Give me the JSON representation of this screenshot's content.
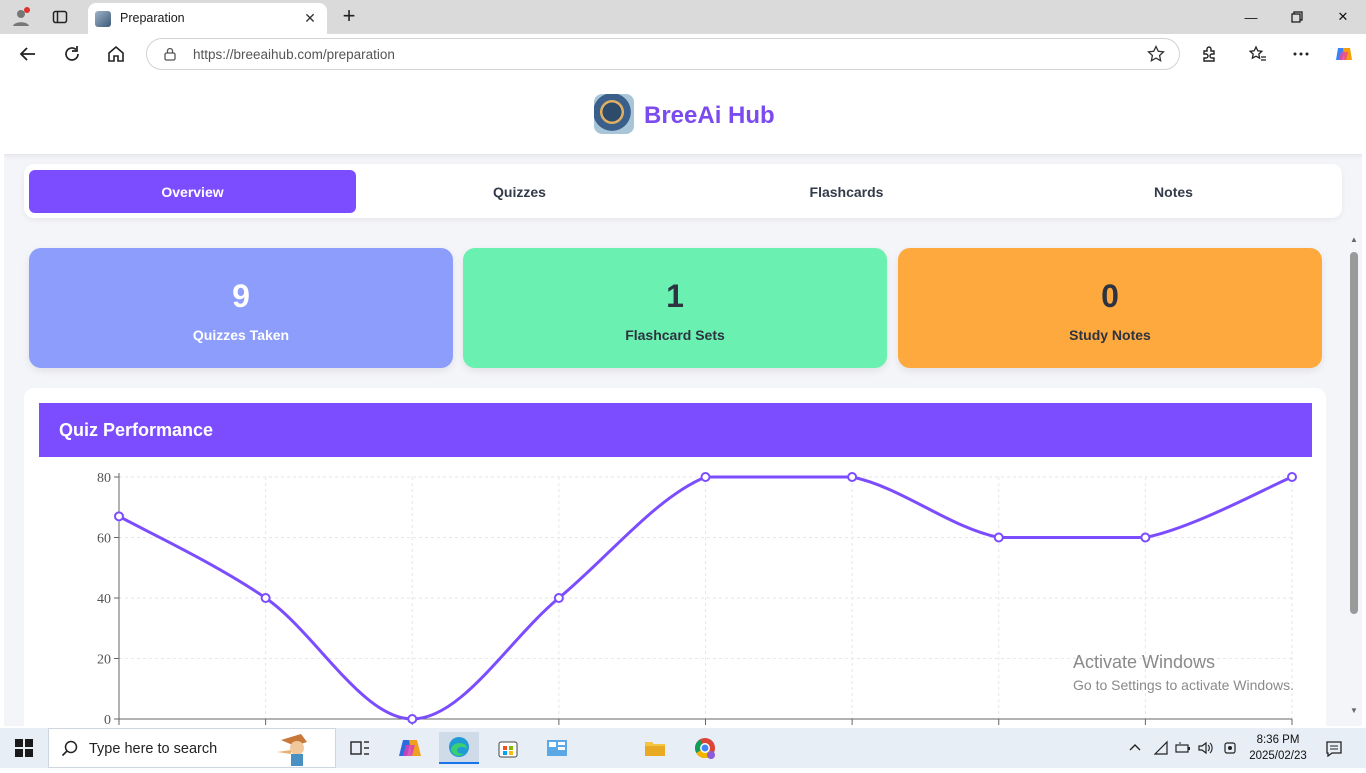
{
  "browser": {
    "tab_title": "Preparation",
    "url": "https://breeaihub.com/preparation"
  },
  "site": {
    "title": "BreeAi Hub"
  },
  "nav_tabs": [
    {
      "label": "Overview",
      "active": true
    },
    {
      "label": "Quizzes",
      "active": false
    },
    {
      "label": "Flashcards",
      "active": false
    },
    {
      "label": "Notes",
      "active": false
    }
  ],
  "stats": [
    {
      "value": "9",
      "label": "Quizzes Taken",
      "bg": "#8c9dfc",
      "text_color": "#ffffff"
    },
    {
      "value": "1",
      "label": "Flashcard Sets",
      "bg": "#6af0b0",
      "text_color": "#2d3340"
    },
    {
      "value": "0",
      "label": "Study Notes",
      "bg": "#fda93e",
      "text_color": "#2d3340"
    }
  ],
  "chart_section": {
    "title": "Quiz Performance"
  },
  "chart_data": {
    "type": "line",
    "x": [
      1,
      2,
      3,
      4,
      5,
      6,
      7,
      8,
      9
    ],
    "series": [
      {
        "values": [
          67,
          40,
          0,
          40,
          80,
          80,
          60,
          60,
          80
        ],
        "color": "#7c4dff"
      }
    ],
    "yticks": [
      "80",
      "60",
      "40",
      "20",
      "0"
    ],
    "ylim": [
      0,
      80
    ],
    "grid": true,
    "smooth": true
  },
  "watermark": {
    "line1": "Activate Windows",
    "line2": "Go to Settings to activate Windows."
  },
  "taskbar": {
    "search_placeholder": "Type here to search",
    "time": "8:36 PM",
    "date": "2025/02/23"
  },
  "colors": {
    "accent": "#7c4dff",
    "brand_title": "#7b4bf0"
  }
}
